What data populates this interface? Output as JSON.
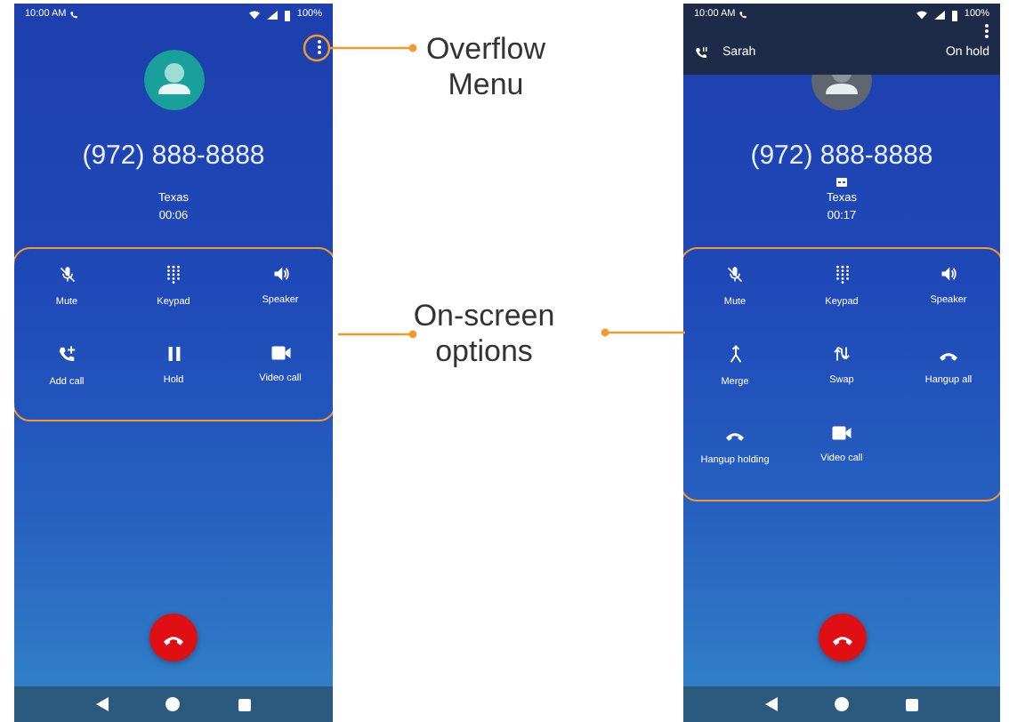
{
  "callouts": [
    {
      "label": "Overflow Menu"
    },
    {
      "label": "On-screen options"
    }
  ],
  "phones": [
    {
      "status_time": "10:00 AM",
      "battery": "100%",
      "number": "(972) 888-8888",
      "location": "Texas",
      "timer": "00:06",
      "options": [
        {
          "kind": "mute",
          "label": "Mute"
        },
        {
          "kind": "keypad",
          "label": "Keypad"
        },
        {
          "kind": "speaker",
          "label": "Speaker"
        },
        {
          "kind": "add-call",
          "label": "Add call"
        },
        {
          "kind": "hold",
          "label": "Hold"
        },
        {
          "kind": "video",
          "label": "Video call"
        }
      ]
    },
    {
      "status_time": "10:00 AM",
      "battery": "100%",
      "held_call": {
        "name": "Sarah",
        "status": "On hold"
      },
      "number": "(972) 888-8888",
      "location": "Texas",
      "timer": "00:17",
      "hd_badge": true,
      "options": [
        {
          "kind": "mute",
          "label": "Mute"
        },
        {
          "kind": "keypad",
          "label": "Keypad"
        },
        {
          "kind": "speaker",
          "label": "Speaker"
        },
        {
          "kind": "merge",
          "label": "Merge"
        },
        {
          "kind": "swap",
          "label": "Swap"
        },
        {
          "kind": "hangup",
          "label": "Hangup all"
        },
        {
          "kind": "hangup",
          "label": "Hangup holding"
        },
        {
          "kind": "video",
          "label": "Video call"
        }
      ]
    }
  ]
}
